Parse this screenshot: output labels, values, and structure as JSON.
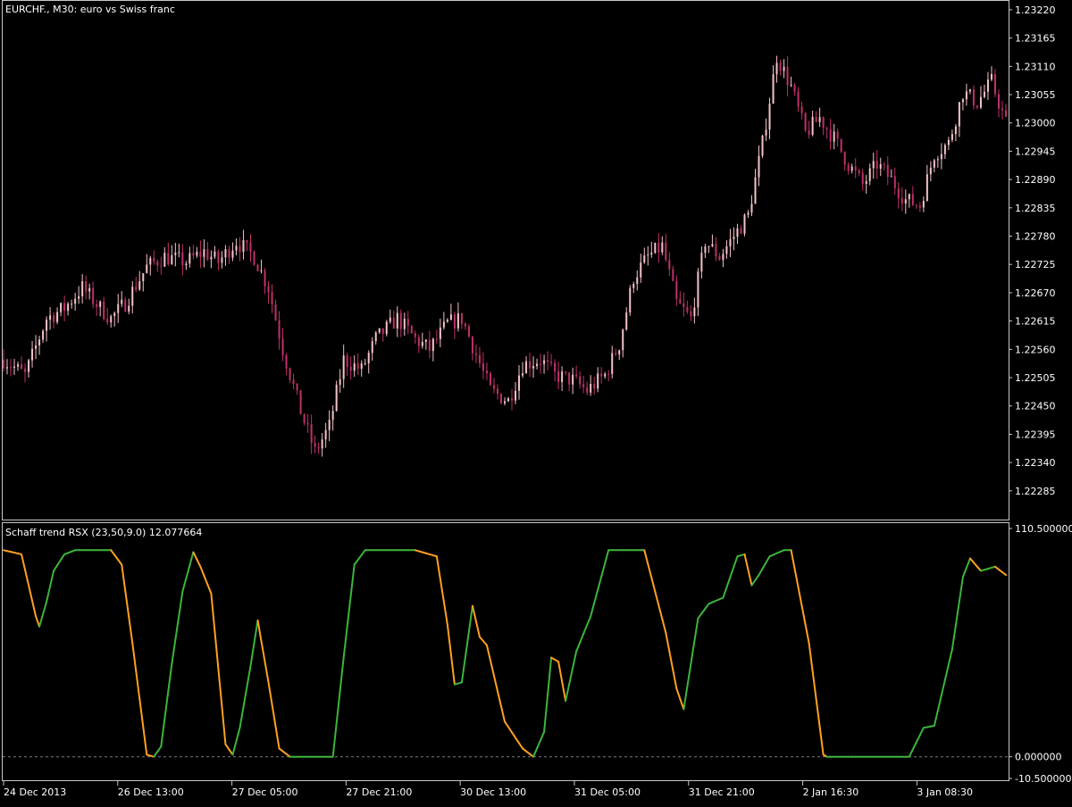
{
  "main_title": "EURCHF., M30:  euro vs Swiss franc",
  "indicator_title": "Schaff trend RSX (23,50,9.0) 12.077664",
  "colors": {
    "background": "#000000",
    "frame": "#c8c8c8",
    "bull_candle": "#f4c2c8",
    "bear_candle": "#c0306a",
    "up_line": "#3cb43c",
    "down_line": "#ffa020",
    "level_line": "#7a7a7a",
    "text": "#ffffff"
  },
  "chart_data": [
    {
      "type": "candlestick",
      "title": "EURCHF., M30:  euro vs Swiss franc",
      "ylim": [
        1.2225,
        1.23225
      ],
      "y_ticks": [
        "1.23220",
        "1.23165",
        "1.23110",
        "1.23055",
        "1.23000",
        "1.22945",
        "1.22890",
        "1.22835",
        "1.22780",
        "1.22725",
        "1.22670",
        "1.22615",
        "1.22560",
        "1.22505",
        "1.22450",
        "1.22395",
        "1.22340",
        "1.22285"
      ],
      "x_ticks": [
        "24 Dec 2013",
        "26 Dec 13:00",
        "27 Dec 05:00",
        "27 Dec 21:00",
        "30 Dec 13:00",
        "31 Dec 05:00",
        "31 Dec 21:00",
        "2 Jan 16:30",
        "3 Jan 08:30"
      ],
      "close_path": [
        [
          0,
          1.2254
        ],
        [
          6,
          1.2251
        ],
        [
          12,
          1.2262
        ],
        [
          17,
          1.2264
        ],
        [
          22,
          1.2268
        ],
        [
          27,
          1.2264
        ],
        [
          30,
          1.2262
        ],
        [
          34,
          1.2265
        ],
        [
          40,
          1.2272
        ],
        [
          45,
          1.2274
        ],
        [
          51,
          1.2273
        ],
        [
          56,
          1.2275
        ],
        [
          60,
          1.2273
        ],
        [
          65,
          1.2277
        ],
        [
          70,
          1.2274
        ],
        [
          74,
          1.2268
        ],
        [
          78,
          1.2256
        ],
        [
          83,
          1.2244
        ],
        [
          87,
          1.2236
        ],
        [
          91,
          1.2241
        ],
        [
          95,
          1.2254
        ],
        [
          100,
          1.2252
        ],
        [
          104,
          1.2258
        ],
        [
          110,
          1.2262
        ],
        [
          115,
          1.2258
        ],
        [
          119,
          1.2256
        ],
        [
          124,
          1.2261
        ],
        [
          128,
          1.2262
        ],
        [
          132,
          1.2255
        ],
        [
          136,
          1.2248
        ],
        [
          141,
          1.2246
        ],
        [
          145,
          1.2253
        ],
        [
          150,
          1.2254
        ],
        [
          154,
          1.2251
        ],
        [
          159,
          1.225
        ],
        [
          163,
          1.2248
        ],
        [
          168,
          1.2251
        ],
        [
          172,
          1.2257
        ],
        [
          176,
          1.227
        ],
        [
          180,
          1.2274
        ],
        [
          184,
          1.2276
        ],
        [
          188,
          1.2265
        ],
        [
          192,
          1.2262
        ],
        [
          196,
          1.2277
        ],
        [
          200,
          1.2274
        ],
        [
          204,
          1.2278
        ],
        [
          208,
          1.2282
        ],
        [
          212,
          1.2296
        ],
        [
          216,
          1.2313
        ],
        [
          220,
          1.2307
        ],
        [
          224,
          1.2298
        ],
        [
          228,
          1.2301
        ],
        [
          232,
          1.2297
        ],
        [
          236,
          1.2292
        ],
        [
          240,
          1.2288
        ],
        [
          244,
          1.2292
        ],
        [
          248,
          1.2289
        ],
        [
          252,
          1.2285
        ],
        [
          256,
          1.2284
        ],
        [
          260,
          1.2294
        ],
        [
          264,
          1.2296
        ],
        [
          268,
          1.2306
        ],
        [
          272,
          1.2304
        ],
        [
          276,
          1.2308
        ],
        [
          280,
          1.23
        ]
      ]
    },
    {
      "type": "line",
      "title": "Schaff trend RSX (23,50,9.0) 12.077664",
      "ylim": [
        -10.5,
        110.5
      ],
      "y_ticks": [
        "110.500000",
        "0.000000",
        "-10.500000"
      ],
      "levels": [
        0
      ],
      "series": [
        {
          "values": [
            [
              0,
              100
            ],
            [
              5,
              98
            ],
            [
              9,
              68
            ],
            [
              10,
              63
            ],
            [
              12,
              75
            ],
            [
              14,
              90
            ],
            [
              17,
              98
            ],
            [
              20,
              100
            ],
            [
              30,
              100
            ],
            [
              33,
              93
            ],
            [
              36,
              55
            ],
            [
              40,
              1
            ],
            [
              42,
              0
            ],
            [
              44,
              5
            ],
            [
              47,
              45
            ],
            [
              50,
              80
            ],
            [
              53,
              99
            ],
            [
              55,
              92
            ],
            [
              58,
              79
            ],
            [
              62,
              6
            ],
            [
              64,
              1
            ],
            [
              66,
              14
            ],
            [
              69,
              44
            ],
            [
              71,
              66
            ],
            [
              74,
              36
            ],
            [
              77,
              4
            ],
            [
              80,
              0
            ],
            [
              92,
              0
            ],
            [
              95,
              48
            ],
            [
              98,
              93
            ],
            [
              101,
              100
            ],
            [
              115,
              100
            ],
            [
              121,
              97
            ],
            [
              124,
              64
            ],
            [
              126,
              35
            ],
            [
              128,
              36
            ],
            [
              131,
              73
            ],
            [
              133,
              58
            ],
            [
              135,
              54
            ],
            [
              140,
              17
            ],
            [
              145,
              4
            ],
            [
              148,
              0
            ],
            [
              151,
              12
            ],
            [
              153,
              48
            ],
            [
              155,
              46
            ],
            [
              157,
              27
            ],
            [
              160,
              51
            ],
            [
              164,
              68
            ],
            [
              169,
              100
            ],
            [
              179,
              100
            ],
            [
              185,
              60
            ],
            [
              188,
              33
            ],
            [
              190,
              23
            ],
            [
              194,
              67
            ],
            [
              197,
              74
            ],
            [
              201,
              77
            ],
            [
              205,
              97
            ],
            [
              207,
              98
            ],
            [
              209,
              83
            ],
            [
              211,
              88
            ],
            [
              214,
              97
            ],
            [
              218,
              100
            ],
            [
              220,
              100
            ],
            [
              225,
              55
            ],
            [
              229,
              1
            ],
            [
              230,
              0
            ],
            [
              253,
              0
            ],
            [
              257,
              14
            ],
            [
              260,
              15
            ],
            [
              265,
              52
            ],
            [
              268,
              87
            ],
            [
              270,
              96
            ],
            [
              273,
              90
            ],
            [
              277,
              92
            ],
            [
              280,
              88
            ]
          ]
        }
      ]
    }
  ]
}
